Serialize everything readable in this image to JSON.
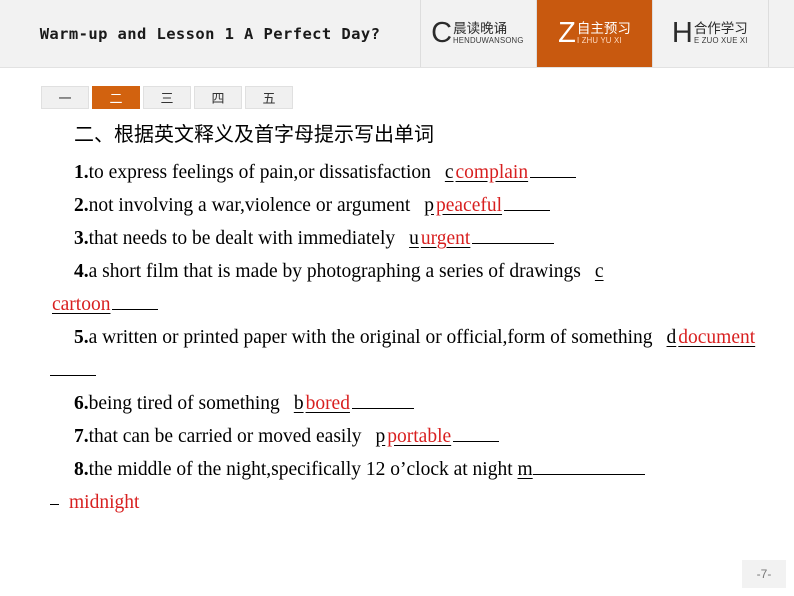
{
  "header": {
    "lesson_title": "Warm-up and Lesson 1  A Perfect Day?",
    "tabs": [
      {
        "letter": "C",
        "cn": "晨读晚诵",
        "pinyin": "HENDUWANSONG",
        "active": false
      },
      {
        "letter": "Z",
        "cn": "自主预习",
        "pinyin": "I ZHU YU XI",
        "active": true
      },
      {
        "letter": "H",
        "cn": "合作学习",
        "pinyin": "E ZUO XUE XI",
        "active": false
      }
    ],
    "accent_color": "#c8590f",
    "bar_color": "#f2f2f2"
  },
  "pills": {
    "items": [
      {
        "label": "一",
        "active": false
      },
      {
        "label": "二",
        "active": true
      },
      {
        "label": "三",
        "active": false
      },
      {
        "label": "四",
        "active": false
      },
      {
        "label": "五",
        "active": false
      }
    ],
    "active_color": "#d2620f"
  },
  "main": {
    "section_title": "二、根据英文释义及首字母提示写出单词",
    "answer_color": "#d81f1f",
    "items": [
      {
        "num": "1.",
        "text": "to express feelings of pain,or dissatisfaction",
        "hint": "c",
        "answer": "complain"
      },
      {
        "num": "2.",
        "text": "not involving a war,violence or argument",
        "hint": "p",
        "answer": "peaceful"
      },
      {
        "num": "3.",
        "text": "that needs to be dealt with immediately",
        "hint": "u",
        "answer": "urgent"
      },
      {
        "num": "4.",
        "text": "a short film that is made by photographing a series of drawings",
        "hint": "c",
        "answer": "cartoon"
      },
      {
        "num": "5.",
        "text": "a written or printed paper with the original or official,form of something",
        "hint": "d",
        "answer": "document"
      },
      {
        "num": "6.",
        "text": "being tired of something",
        "hint": "b",
        "answer": "bored"
      },
      {
        "num": "7.",
        "text": "that can be carried or moved easily",
        "hint": "p",
        "answer": "portable"
      },
      {
        "num": "8.",
        "text": "the middle of the night,specifically 12 o’clock at night",
        "hint": "m",
        "answer": "midnight"
      }
    ]
  },
  "footer": {
    "page_label": "-7-"
  }
}
